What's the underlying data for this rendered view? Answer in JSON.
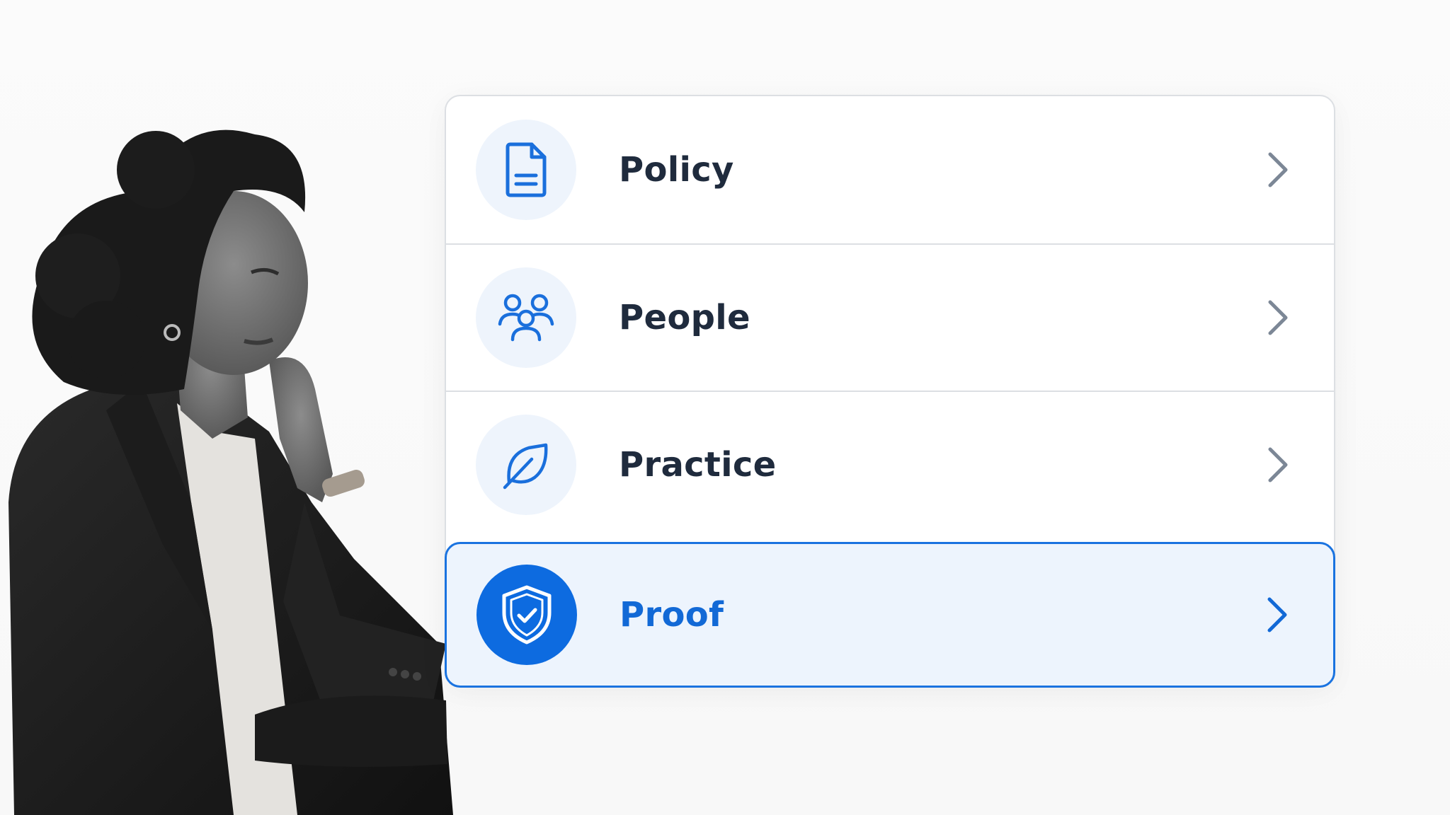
{
  "menu": {
    "items": [
      {
        "label": "Policy",
        "icon": "document-icon",
        "selected": false
      },
      {
        "label": "People",
        "icon": "people-group-icon",
        "selected": false
      },
      {
        "label": "Practice",
        "icon": "leaf-icon",
        "selected": false
      },
      {
        "label": "Proof",
        "icon": "shield-check-icon",
        "selected": true
      }
    ]
  },
  "colors": {
    "accent": "#1a73e0",
    "selected_background": "#edf4fd",
    "icon_badge_background": "#eef4fc",
    "label_text": "#1f2b3d",
    "chevron": "#7c8796"
  }
}
